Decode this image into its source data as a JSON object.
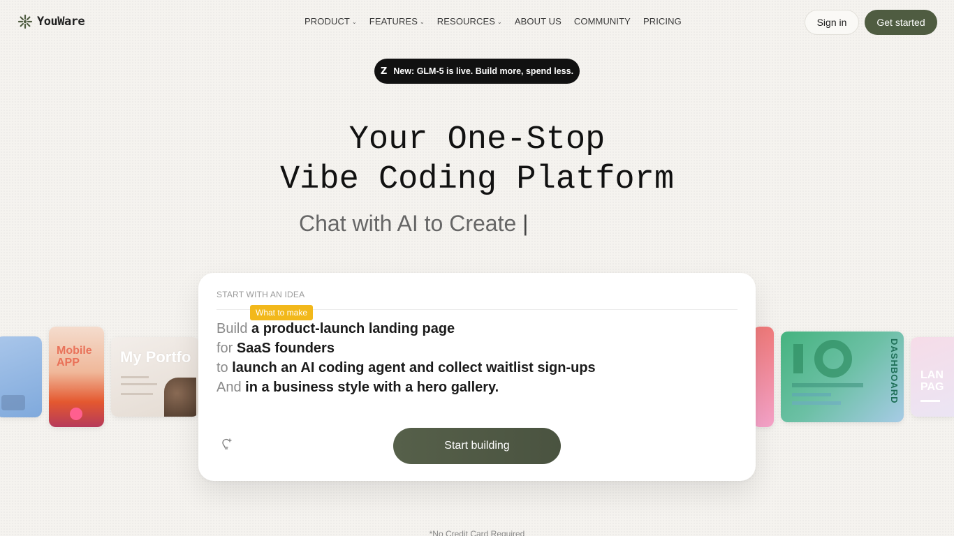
{
  "brand": {
    "name": "YouWare"
  },
  "nav": {
    "items": [
      {
        "label": "PRODUCT",
        "dropdown": true
      },
      {
        "label": "FEATURES",
        "dropdown": true
      },
      {
        "label": "RESOURCES",
        "dropdown": true
      },
      {
        "label": "ABOUT US",
        "dropdown": false
      },
      {
        "label": "COMMUNITY",
        "dropdown": false
      },
      {
        "label": "PRICING",
        "dropdown": false
      }
    ],
    "dropdown_glyph": "⌄",
    "signin_label": "Sign in",
    "get_started_label": "Get started"
  },
  "announcement": {
    "icon": "zhipu-logo-icon",
    "icon_glyph": "Z",
    "text": "New: GLM-5 is live. Build more, spend less."
  },
  "hero": {
    "headline_line1": "Your One-Stop",
    "headline_line2": "Vibe Coding Platform",
    "subheadline": "Chat with AI to Create",
    "cursor": "|"
  },
  "showcase": {
    "left_cards": [
      {
        "label": "",
        "colors": [
          "#8fb3e0",
          "#b9d3ef"
        ]
      },
      {
        "label": "Mobile APP",
        "colors": [
          "#f3d7c7",
          "#e6603a"
        ]
      },
      {
        "label": "My Portfo",
        "colors": [
          "#efe8e3",
          "#d9cfc5"
        ]
      }
    ],
    "right_cards": [
      {
        "label": "",
        "colors": [
          "#f08a8a",
          "#f2a4c9"
        ]
      },
      {
        "label": "DASHBOARD",
        "colors": [
          "#4fb58a",
          "#9ad0e8"
        ]
      },
      {
        "label": "LAN PAG",
        "colors": [
          "#f2d6e4",
          "#e7e2f3"
        ]
      }
    ]
  },
  "composer": {
    "section_label": "START WITH AN IDEA",
    "tag": "What to make",
    "lines": [
      {
        "keyword": "Build",
        "value": "a product-launch landing page"
      },
      {
        "keyword": "for",
        "value": "SaaS founders"
      },
      {
        "keyword": "to",
        "value": "launch an AI coding agent and collect waitlist sign-ups"
      },
      {
        "keyword": "And",
        "value": "in a business style with a hero gallery."
      }
    ],
    "idea_icon": "lightbulb-sparkle-icon",
    "submit_label": "Start building"
  },
  "footnote": "*No Credit Card Required",
  "colors": {
    "background": "#f5f3ef",
    "accent": "#4f5c41",
    "tag": "#f2b81b",
    "announcement_bg": "#111111"
  }
}
